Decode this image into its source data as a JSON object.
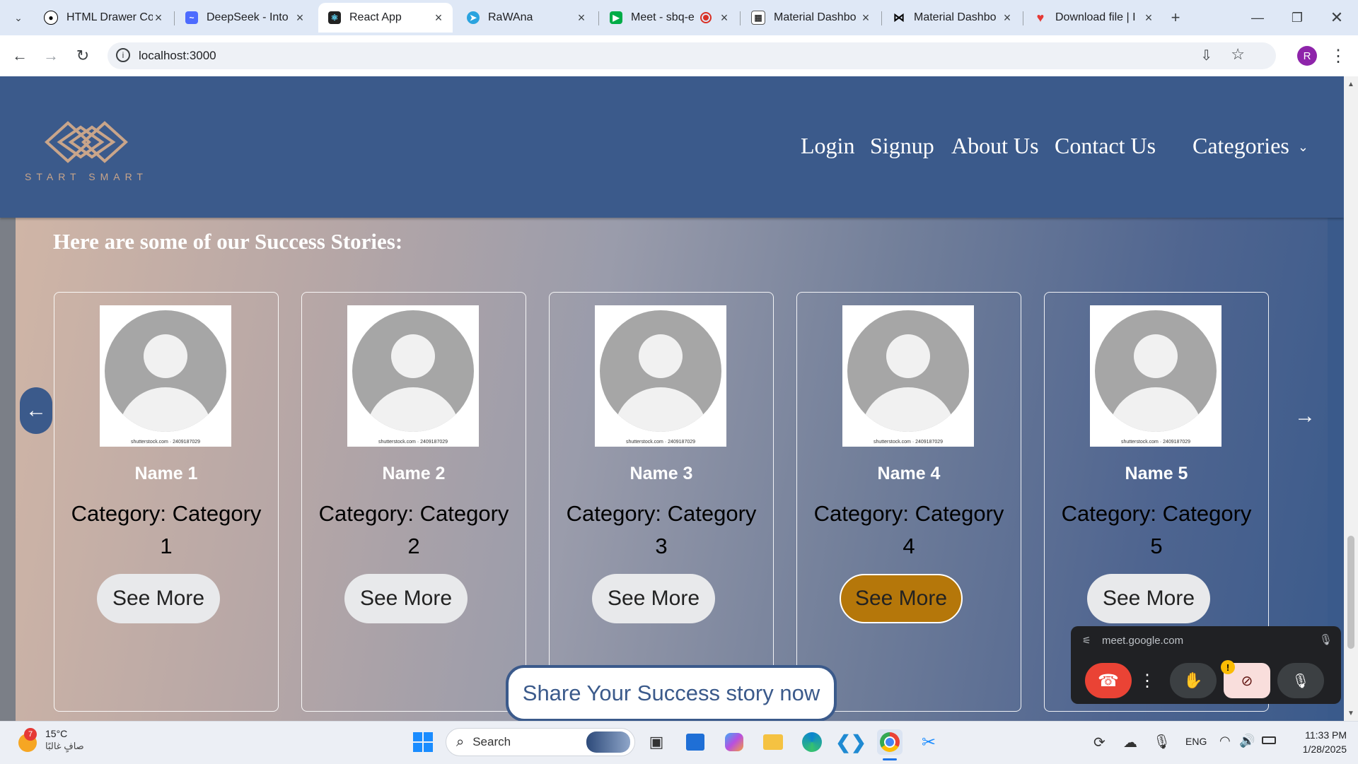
{
  "browser": {
    "tabs": [
      {
        "title": "HTML Drawer Co",
        "favicon": "github-icon",
        "active": false
      },
      {
        "title": "DeepSeek - Into",
        "favicon": "deepseek-icon",
        "active": false
      },
      {
        "title": "React App",
        "favicon": "react-icon",
        "active": true
      },
      {
        "title": "RaWAna",
        "favicon": "telegram-icon",
        "active": false
      },
      {
        "title": "Meet - sbq-e",
        "favicon": "google-meet-icon",
        "active": false
      },
      {
        "title": "Material Dashbo",
        "favicon": "material-icon",
        "active": false
      },
      {
        "title": "Material Dashbo",
        "favicon": "bow-icon",
        "active": false
      },
      {
        "title": "Download file | I",
        "favicon": "heart-icon",
        "active": false
      }
    ],
    "address": "localhost:3000",
    "profile_initial": "R"
  },
  "site": {
    "logo_text": "START SMART",
    "nav": {
      "login": "Login",
      "signup": "Signup",
      "about": "About Us",
      "contact": "Contact Us",
      "categories": "Categories"
    },
    "headline": "Here are some of our Success Stories:",
    "stories": [
      {
        "name": "Name 1",
        "category": "Category: Category 1",
        "button": "See More",
        "credit": "shutterstock.com · 2409187029"
      },
      {
        "name": "Name 2",
        "category": "Category: Category 2",
        "button": "See More",
        "credit": "shutterstock.com · 2409187029"
      },
      {
        "name": "Name 3",
        "category": "Category: Category 3",
        "button": "See More",
        "credit": "shutterstock.com · 2409187029"
      },
      {
        "name": "Name 4",
        "category": "Category: Category 4",
        "button": "See More",
        "credit": "shutterstock.com · 2409187029",
        "highlighted": true
      },
      {
        "name": "Name 5",
        "category": "Category: Category 5",
        "button": "See More",
        "credit": "shutterstock.com · 2409187029"
      }
    ],
    "prev_arrow": "←",
    "next_arrow": "→",
    "share_button": "Share Your Success story now",
    "colors": {
      "header": "#3b5a8b",
      "highlight_button": "#b5770a"
    }
  },
  "meet_pip": {
    "url": "meet.google.com"
  },
  "taskbar": {
    "weather_temp": "15°C",
    "weather_desc": "صافٍ غالبًا",
    "weather_badge": "7",
    "search_label": "Search",
    "language": "ENG",
    "time": "11:33 PM",
    "date": "1/28/2025"
  }
}
